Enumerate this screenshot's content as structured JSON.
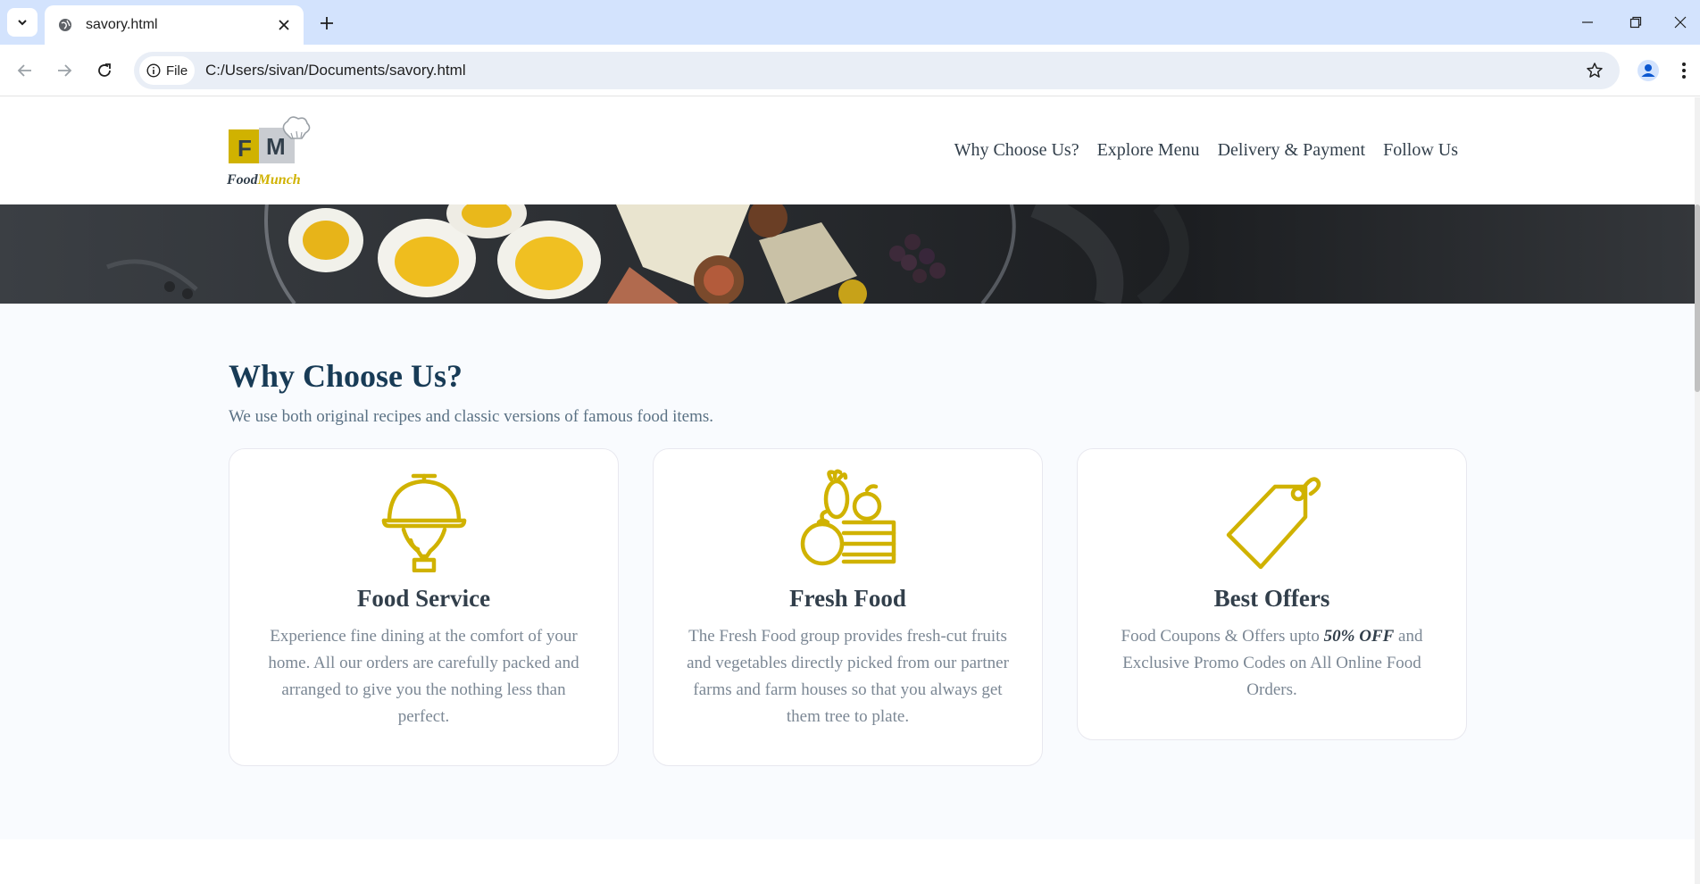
{
  "browser": {
    "tab_title": "savory.html",
    "site_chip_label": "File",
    "url": "C:/Users/sivan/Documents/savory.html",
    "icons": [
      "tab-list-icon",
      "globe-icon",
      "close-icon",
      "plus-icon",
      "minimize-icon",
      "restore-icon",
      "window-close-icon",
      "back-arrow-icon",
      "forward-arrow-icon",
      "reload-icon",
      "info-icon",
      "star-icon",
      "profile-icon",
      "more-vert-icon"
    ]
  },
  "site": {
    "logo": {
      "name_part1": "Food",
      "name_part2": "Munch",
      "badge_letters": "FM"
    },
    "nav": [
      {
        "label": "Why Choose Us?"
      },
      {
        "label": "Explore Menu"
      },
      {
        "label": "Delivery & Payment"
      },
      {
        "label": "Follow Us"
      }
    ]
  },
  "why_choose_us": {
    "title": "Why Choose Us?",
    "description": "We use both original recipes and classic versions of famous food items.",
    "cards": [
      {
        "icon": "cloche-icon",
        "title": "Food Service",
        "description": "Experience fine dining at the comfort of your home. All our orders are carefully packed and arranged to give you the nothing less than perfect."
      },
      {
        "icon": "fresh-produce-icon",
        "title": "Fresh Food",
        "description": "The Fresh Food group provides fresh-cut fruits and vegetables directly picked from our partner farms and farm houses so that you always get them tree to plate."
      },
      {
        "icon": "price-tag-icon",
        "title": "Best Offers",
        "description_before": "Food Coupons & Offers upto ",
        "description_highlight": "50% OFF",
        "description_after": " and Exclusive Promo Codes on All Online Food Orders."
      }
    ]
  },
  "colors": {
    "accent": "#d0b200",
    "heading": "#183b56",
    "text_muted": "#7b8794",
    "nav_text": "#323f4b",
    "section_bg": "#f9fbfe",
    "browser_tabbar": "#d3e3fd"
  }
}
